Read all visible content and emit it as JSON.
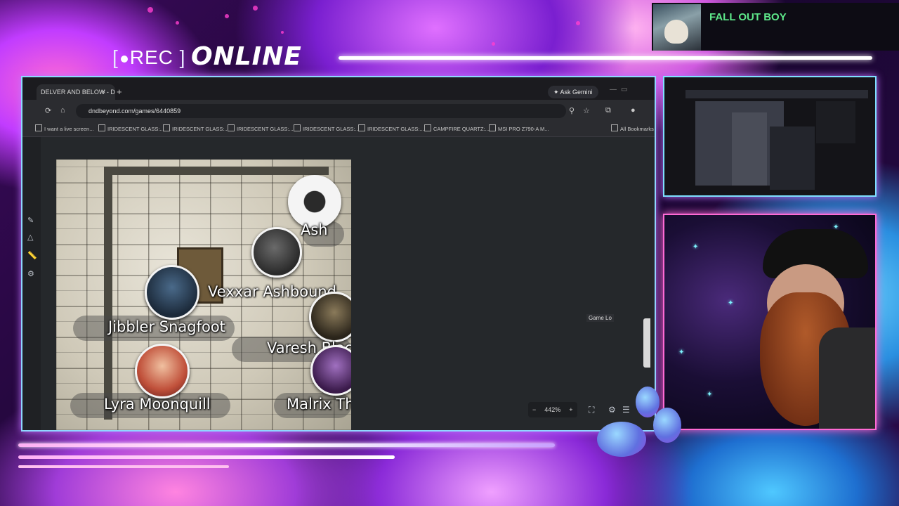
{
  "overlay": {
    "rec_text": "[●REC]",
    "rec_label": "REC",
    "online_label": "ONLINE",
    "now_playing_artist": "FALL OUT BOY"
  },
  "browser": {
    "tab_title": "DELVER AND BELOW - D&",
    "tab_close": "×",
    "new_tab": "+",
    "gemini_label": "Ask Gemini",
    "url": "dndbeyond.com/games/6440859",
    "bookmarks": [
      "I want a live screen...",
      "IRIDESCENT GLASS:...",
      "IRIDESCENT GLASS:...",
      "IRIDESCENT GLASS:...",
      "IRIDESCENT GLASS:...",
      "IRIDESCENT GLASS:...",
      "CAMPFIRE QUARTZ:...",
      "MSI PRO Z790-A M..."
    ],
    "all_bookmarks": "All Bookmarks"
  },
  "map": {
    "tokens": [
      {
        "name": "Ash"
      },
      {
        "name": "Vexxar Ashbound"
      },
      {
        "name": "Jibbler Snagfoot"
      },
      {
        "name": "Varesh Blacks"
      },
      {
        "name": "Lyra Moonquill"
      },
      {
        "name": "Malrix Tho"
      }
    ],
    "zoom_minus": "−",
    "zoom_level": "442%",
    "zoom_plus": "+",
    "game_log_label": "Game Lo"
  },
  "colors": {
    "accent_pink": "#ff6ad5",
    "accent_cyan": "#7ee0ff",
    "now_playing_green": "#5ee88a"
  }
}
